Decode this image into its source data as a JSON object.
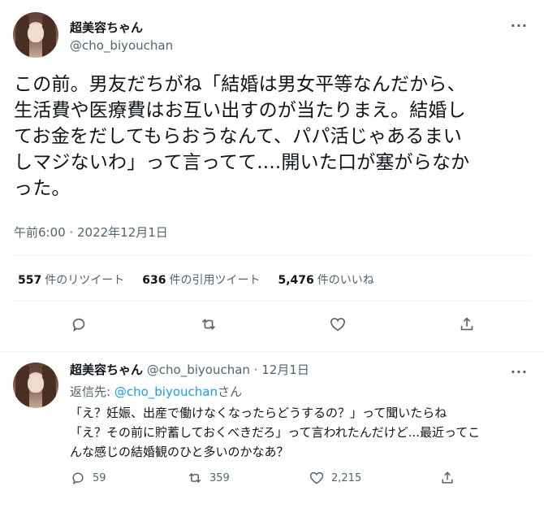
{
  "tweet": {
    "display_name": "超美容ちゃん",
    "handle": "@cho_biyouchan",
    "more": "···",
    "text": "この前。男友だちがね「結婚は男女平等なんだから、\n生活費や医療費はお互い出すのが当たりまえ。結婚し\nてお金をだしてもらおうなんて、パパ活じゃあるまい\nしマジないわ」って言ってて....開いた口が塞がらなか\nった。",
    "timestamp": "午前6:00 · 2022年12月1日",
    "stats": {
      "retweets_num": "557",
      "retweets_label": "件のリツイート",
      "quotes_num": "636",
      "quotes_label": "件の引用ツイート",
      "likes_num": "5,476",
      "likes_label": "件のいいね"
    },
    "icons": [
      "reply-icon",
      "retweet-icon",
      "like-icon",
      "share-icon"
    ]
  },
  "reply": {
    "display_name": "超美容ちゃん",
    "meta": "@cho_biyouchan · 12月1日",
    "more": "···",
    "reply_to_prefix": "返信先: ",
    "reply_to_mention": "@cho_biyouchan",
    "reply_to_suffix": "さん",
    "text": "「え？妊娠、出産で働けなくなったらどうするの？」って聞いたらね\n「え？その前に貯蓄しておくべきだろ」って言われたんだけど...最近ってこ\nんな感じの結婚観のひと多いのかなあ？",
    "reply_count": "59",
    "retweet_count": "359",
    "like_count": "2,215"
  },
  "colors": {
    "text": "#0f1419",
    "secondary": "#536471",
    "link": "#1d9bf0",
    "border": "#eff3f4"
  }
}
